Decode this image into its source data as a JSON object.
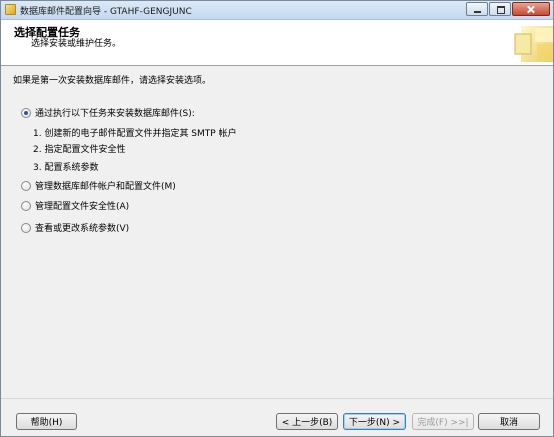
{
  "window": {
    "title": "数据库邮件配置向导 - GTAHF-GENGJUNC"
  },
  "header": {
    "title": "选择配置任务",
    "subtitle": "选择安装或维护任务。"
  },
  "main": {
    "intro": "如果是第一次安装数据库邮件，请选择安装选项。",
    "options": [
      {
        "label": "通过执行以下任务来安装数据库邮件(S):",
        "selected": true
      },
      {
        "label": "管理数据库邮件帐户和配置文件(M)",
        "selected": false
      },
      {
        "label": "管理配置文件安全性(A)",
        "selected": false
      },
      {
        "label": "查看或更改系统参数(V)",
        "selected": false
      }
    ],
    "steps": [
      "1.  创建新的电子邮件配置文件并指定其 SMTP 帐户",
      "2.  指定配置文件安全性",
      "3.  配置系统参数"
    ]
  },
  "footer": {
    "help": "帮助(H)",
    "back": "< 上一步(B)",
    "next": "下一步(N) >",
    "finish": "完成(F) >>|",
    "cancel": "取消"
  }
}
